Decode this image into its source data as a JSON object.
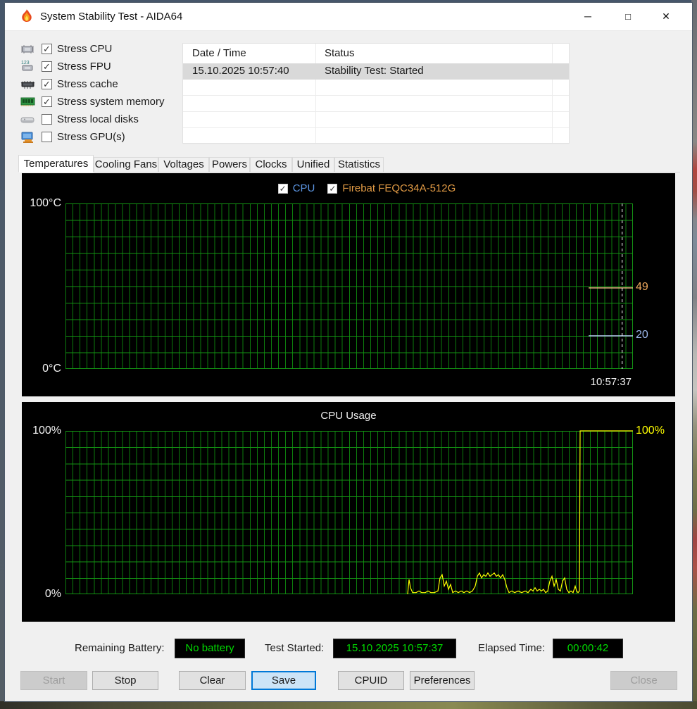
{
  "titlebar": {
    "title": "System Stability Test - AIDA64",
    "minimize_icon": "─",
    "maximize_icon": "□",
    "close_icon": "✕"
  },
  "stress_options": [
    {
      "label": "Stress CPU",
      "checked": true,
      "icon": "cpu-chip-icon"
    },
    {
      "label": "Stress FPU",
      "checked": true,
      "icon": "fpu-chip-icon"
    },
    {
      "label": "Stress cache",
      "checked": true,
      "icon": "cache-chip-icon"
    },
    {
      "label": "Stress system memory",
      "checked": true,
      "icon": "memory-module-icon"
    },
    {
      "label": "Stress local disks",
      "checked": false,
      "icon": "hard-disk-icon"
    },
    {
      "label": "Stress GPU(s)",
      "checked": false,
      "icon": "gpu-card-icon"
    }
  ],
  "log_table": {
    "columns": [
      "Date / Time",
      "Status"
    ],
    "rows": [
      {
        "datetime": "15.10.2025 10:57:40",
        "status": "Stability Test: Started",
        "selected": true
      }
    ]
  },
  "tabs": [
    {
      "label": "Temperatures",
      "active": true
    },
    {
      "label": "Cooling Fans",
      "active": false
    },
    {
      "label": "Voltages",
      "active": false
    },
    {
      "label": "Powers",
      "active": false
    },
    {
      "label": "Clocks",
      "active": false
    },
    {
      "label": "Unified",
      "active": false
    },
    {
      "label": "Statistics",
      "active": false
    }
  ],
  "chart_data": [
    {
      "type": "line",
      "name": "temperature-chart",
      "y_axis": {
        "top_label": "100°C",
        "bottom_label": "0°C",
        "min": 0,
        "max": 100
      },
      "legend": [
        {
          "label": "CPU",
          "checked": true,
          "color": "#5b94e0"
        },
        {
          "label": "Firebat FEQC34A-512G",
          "checked": true,
          "color": "#e29b45"
        }
      ],
      "series": [
        {
          "name": "Firebat FEQC34A-512G",
          "value": 49,
          "value_label": "49",
          "color": "#f5c089",
          "label_color": "#f0aa5e"
        },
        {
          "name": "CPU",
          "value": 20,
          "value_label": "20",
          "color": "#b8ccf2",
          "label_color": "#9cb8ec"
        }
      ],
      "data_start_frac": 0.922,
      "cursor_frac": 0.981,
      "cursor_time_label": "10:57:37"
    },
    {
      "type": "line",
      "name": "cpu-usage-chart",
      "title": "CPU Usage",
      "y_axis": {
        "top_label": "100%",
        "bottom_label": "0%",
        "min": 0,
        "max": 100
      },
      "current_value_label": "100%",
      "line_color": "#ffff00",
      "points": [
        [
          486,
          0
        ],
        [
          488,
          9
        ],
        [
          490,
          4
        ],
        [
          493,
          1
        ],
        [
          498,
          1
        ],
        [
          502,
          2
        ],
        [
          506,
          1
        ],
        [
          511,
          1
        ],
        [
          515,
          2
        ],
        [
          519,
          1
        ],
        [
          524,
          1
        ],
        [
          529,
          2
        ],
        [
          532,
          10
        ],
        [
          535,
          12
        ],
        [
          538,
          5
        ],
        [
          541,
          8
        ],
        [
          544,
          3
        ],
        [
          547,
          6
        ],
        [
          550,
          1
        ],
        [
          554,
          2
        ],
        [
          558,
          1
        ],
        [
          562,
          2
        ],
        [
          566,
          1
        ],
        [
          570,
          2
        ],
        [
          574,
          1
        ],
        [
          578,
          2
        ],
        [
          582,
          5
        ],
        [
          585,
          11
        ],
        [
          588,
          13
        ],
        [
          591,
          10
        ],
        [
          594,
          12
        ],
        [
          597,
          11
        ],
        [
          600,
          13
        ],
        [
          603,
          11
        ],
        [
          606,
          12
        ],
        [
          609,
          13
        ],
        [
          612,
          11
        ],
        [
          615,
          12
        ],
        [
          618,
          10
        ],
        [
          621,
          12
        ],
        [
          624,
          9
        ],
        [
          627,
          4
        ],
        [
          630,
          1
        ],
        [
          634,
          2
        ],
        [
          638,
          1
        ],
        [
          643,
          2
        ],
        [
          648,
          1
        ],
        [
          653,
          2
        ],
        [
          657,
          1
        ],
        [
          661,
          3
        ],
        [
          664,
          2
        ],
        [
          667,
          4
        ],
        [
          670,
          2
        ],
        [
          673,
          3
        ],
        [
          676,
          2
        ],
        [
          679,
          3
        ],
        [
          682,
          1
        ],
        [
          685,
          2
        ],
        [
          688,
          8
        ],
        [
          691,
          11
        ],
        [
          694,
          5
        ],
        [
          697,
          9
        ],
        [
          700,
          3
        ],
        [
          703,
          2
        ],
        [
          706,
          8
        ],
        [
          709,
          10
        ],
        [
          712,
          3
        ],
        [
          715,
          1
        ],
        [
          718,
          2
        ],
        [
          721,
          1
        ],
        [
          724,
          5
        ],
        [
          726,
          2
        ],
        [
          728,
          1
        ],
        [
          730,
          2
        ],
        [
          731,
          100
        ],
        [
          806,
          100
        ]
      ]
    }
  ],
  "status_bar": {
    "battery_label": "Remaining Battery:",
    "battery_value": "No battery",
    "started_label": "Test Started:",
    "started_value": "15.10.2025 10:57:37",
    "elapsed_label": "Elapsed Time:",
    "elapsed_value": "00:00:42",
    "value_color": "#00dc00"
  },
  "buttons": [
    {
      "label": "Start",
      "disabled": true
    },
    {
      "label": "Stop",
      "disabled": false
    },
    {
      "label": "Clear",
      "disabled": false
    },
    {
      "label": "Save",
      "disabled": false,
      "default": true
    },
    {
      "label": "CPUID",
      "disabled": false
    },
    {
      "label": "Preferences",
      "disabled": false
    },
    {
      "label": "Close",
      "disabled": true
    }
  ]
}
